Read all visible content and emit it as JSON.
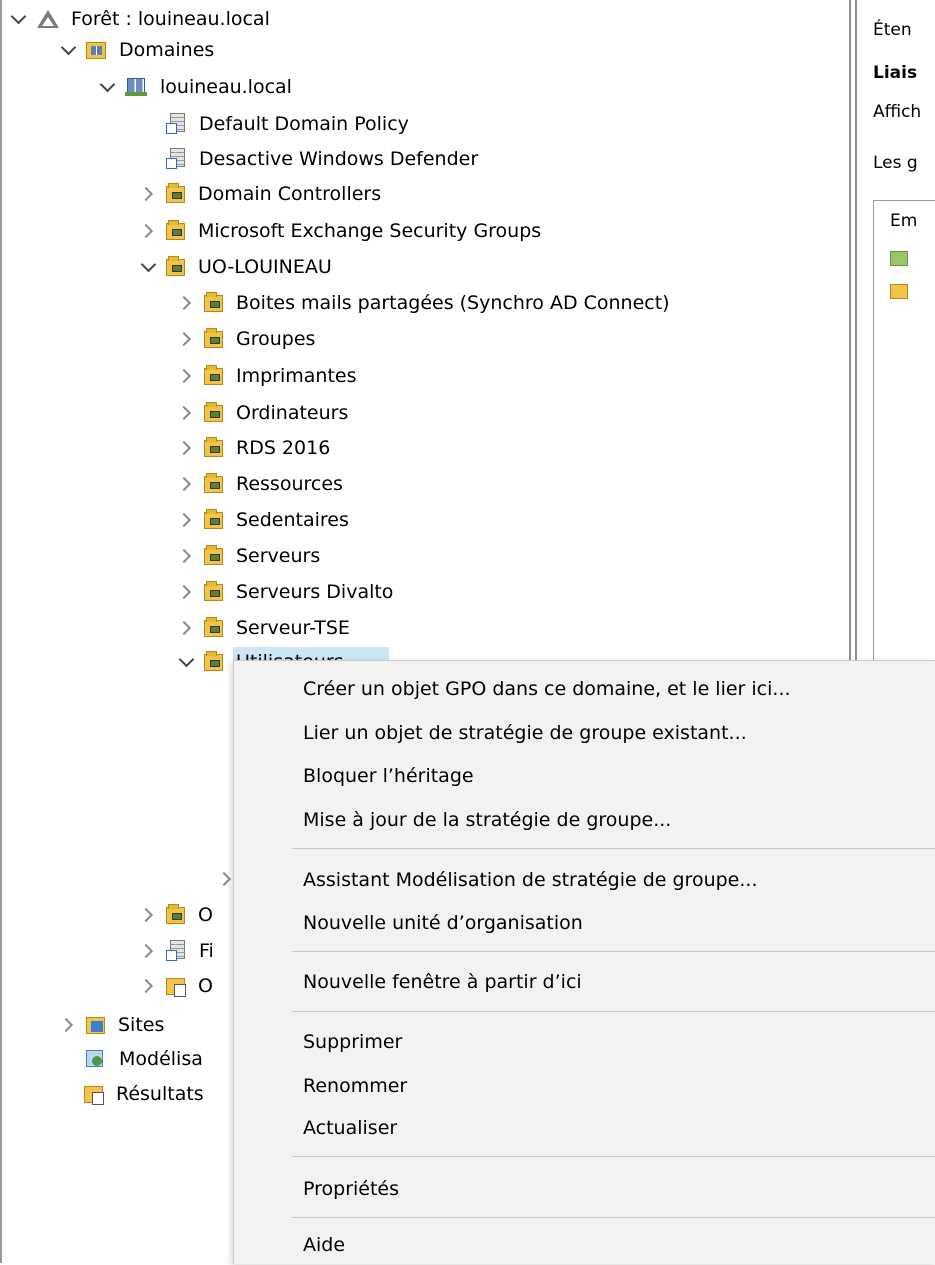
{
  "tree": {
    "forest": "Forêt : louineau.local",
    "domaines": "Domaines",
    "domain": "louineau.local",
    "gpo_links": [
      "Default Domain Policy",
      "Desactive Windows Defender"
    ],
    "ou_top": [
      "Domain Controllers",
      "Microsoft Exchange Security Groups"
    ],
    "uo_root": "UO-LOUINEAU",
    "uo_children": [
      "Boites mails partagées (Synchro AD Connect)",
      "Groupes",
      "Imprimantes",
      "Ordinateurs",
      "RDS 2016",
      "Ressources",
      "Sedentaires",
      "Serveurs",
      "Serveurs Divalto",
      "Serveur-TSE"
    ],
    "selected_partial": "Utilisateurs",
    "peek_items": [
      "O",
      "Fi",
      "O"
    ],
    "root_items": [
      "Sites",
      "Modélisa",
      "Résultats"
    ]
  },
  "right_pane": {
    "lines": [
      "Éten",
      "Liais",
      "Affich",
      "Les g",
      "Em"
    ]
  },
  "context_menu": {
    "items": [
      "Créer un objet GPO dans ce domaine, et le lier ici...",
      "Lier un objet de stratégie de groupe existant...",
      "Bloquer l’héritage",
      "Mise à jour de la stratégie de groupe...",
      "Assistant Modélisation de stratégie de groupe...",
      "Nouvelle unité d’organisation",
      "Nouvelle fenêtre à partir d’ici",
      "Supprimer",
      "Renommer",
      "Actualiser",
      "Propriétés",
      "Aide"
    ]
  }
}
